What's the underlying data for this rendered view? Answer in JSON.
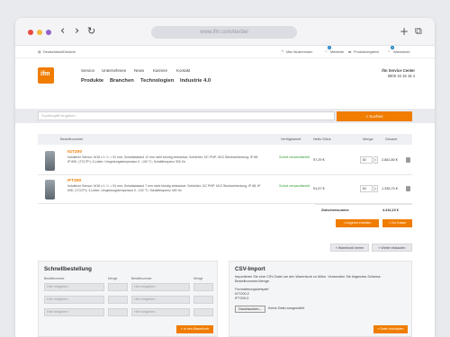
{
  "browser": {
    "url": "www.ifm.com/de/de/",
    "back_glyph": "‹",
    "forward_glyph": "›",
    "reload_glyph": "↻",
    "newtab_glyph": "+",
    "tabs_glyph": "⧉",
    "dot_colors": [
      "#e84a3f",
      "#f2b93b",
      "#8f62c9"
    ]
  },
  "topbar": {
    "locale": "Deutschland/Deutsch",
    "user": "Max Mustermann",
    "merkliste": "Merkliste",
    "merkliste_count": "1",
    "produktvergleich": "Produktvergleich",
    "warenkorb": "Warenkorb",
    "warenkorb_count": "2"
  },
  "header": {
    "logo_text": "ifm",
    "subnav": [
      "Service",
      "Unternehmen",
      "News",
      "Karriere",
      "Kontakt"
    ],
    "mainnav": [
      "Produkte",
      "Branchen",
      "Technologien",
      "Industrie 4.0"
    ],
    "service_title": "ifm Service Center",
    "service_phone": "0800 16 16 16 4"
  },
  "search": {
    "placeholder": "Suchbegriff eingeben",
    "button_label": "Suchen"
  },
  "cart": {
    "headers": {
      "item": "Bestellnummer",
      "availability": "Verfügbarkeit",
      "unit_price": "Netto Stück",
      "qty": "Menge",
      "total": "Gesamt"
    },
    "rows": [
      {
        "id": "IGT200",
        "desc": "Induktiver Sensor; M18 x 1 / L = 51 mm; Schaltabstand 12 mm nicht bündig einbaubar; Schließer; DC PNP; M12 Steckverbindung; IP 68; IP 69K; (TCCP*); 3-Leiter; Umgebungstemperatur 0...100 °C; Schaltfrequenz 300 Hz",
        "availability": "Sofort versandbereit",
        "price": "97,29 €",
        "qty": "30",
        "total": "2.862,80 €"
      },
      {
        "id": "IFT200",
        "desc": "Induktiver Sensor; M18 x 1 / L = 51 mm; Schaltabstand 7 mm nicht bündig einbaubar; Schließer; DC PNP; M12 Steckverbindung; IP 68; IP 69K; (TCCP*); 3-Leiter; Umgebungstemperatur 0...100 °C; Schaltfrequenz 300 Hz",
        "availability": "Sofort versandbereit",
        "price": "91,97 €",
        "qty": "30",
        "total": "1.335,70 €"
      }
    ],
    "subtotal_label": "Zwischensumme",
    "subtotal_value": "4.416,15 €",
    "offer_button": "Angebot erstellen",
    "checkout_button": "Zur Kasse",
    "clear_button": "Warenkorb leeren",
    "continue_button": "Weiter einkaufen"
  },
  "quick_order": {
    "title": "Schnellbestellung",
    "col_label_item": "Bestellnummer",
    "col_label_qty": "Menge",
    "field_placeholder": "Hier eingeben",
    "submit_button": "In den Warenkorb"
  },
  "csv_import": {
    "title": "CSV-Import",
    "intro": "Importieren Sie eine CSV-Datei um den Warenkorb zu füllen. Verwenden Sie folgendes Schema: Bestellnummer;Menge",
    "example_label": "Formatierungsbeispiel",
    "example_line1": "IGT200;2",
    "example_line2": "IFT200;3",
    "browse_button": "Durchsuchen...",
    "file_status": "Keine Datei ausgewählt.",
    "submit_button": "Datei hochladen"
  },
  "colors": {
    "brand_orange": "#f07c00",
    "available_green": "#2c9e2c"
  }
}
